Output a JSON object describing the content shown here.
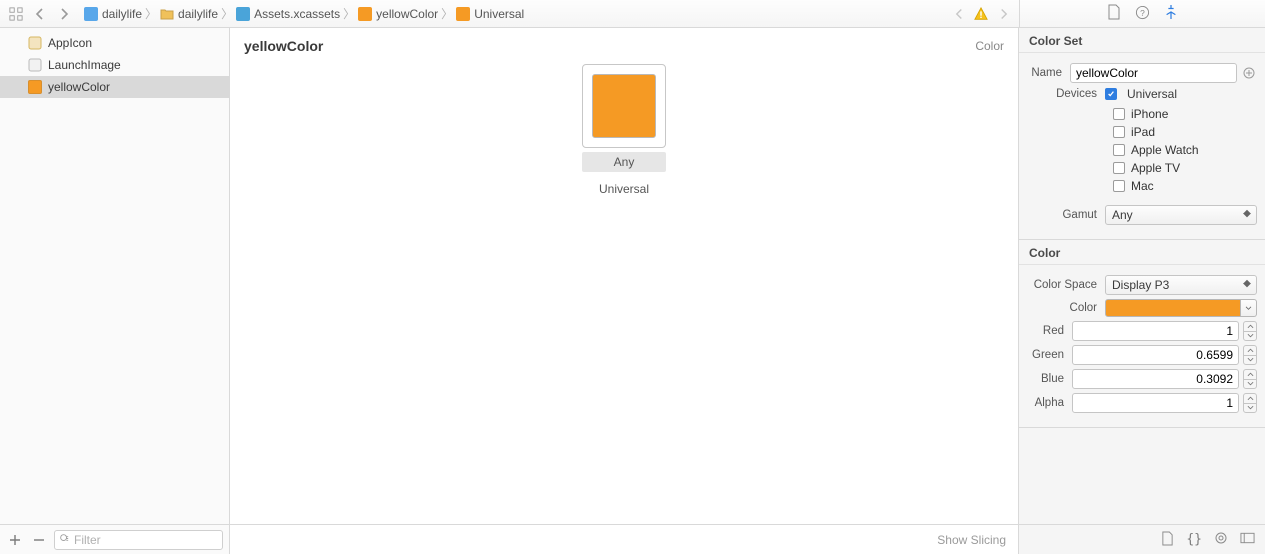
{
  "accent_color": "#f59a24",
  "breadcrumbs": {
    "item0": "dailylife",
    "item1": "dailylife",
    "item2": "Assets.xcassets",
    "item3": "yellowColor",
    "item4": "Universal"
  },
  "sidebar": {
    "items": {
      "i0": "AppIcon",
      "i1": "LaunchImage",
      "i2": "yellowColor"
    },
    "filter_placeholder": "Filter"
  },
  "editor": {
    "title": "yellowColor",
    "head_right": "Color",
    "well_tag": "Any",
    "well_sub": "Universal",
    "footer_action": "Show Slicing"
  },
  "inspector": {
    "colorset_title": "Color Set",
    "name_label": "Name",
    "name_value": "yellowColor",
    "devices_label": "Devices",
    "devices": {
      "universal": "Universal",
      "iphone": "iPhone",
      "ipad": "iPad",
      "watch": "Apple Watch",
      "tv": "Apple TV",
      "mac": "Mac"
    },
    "gamut_label": "Gamut",
    "gamut_value": "Any",
    "color_title": "Color",
    "colorspace_label": "Color Space",
    "colorspace_value": "Display P3",
    "color_label": "Color",
    "red_label": "Red",
    "red_value": "1",
    "green_label": "Green",
    "green_value": "0.6599",
    "blue_label": "Blue",
    "blue_value": "0.3092",
    "alpha_label": "Alpha",
    "alpha_value": "1"
  }
}
